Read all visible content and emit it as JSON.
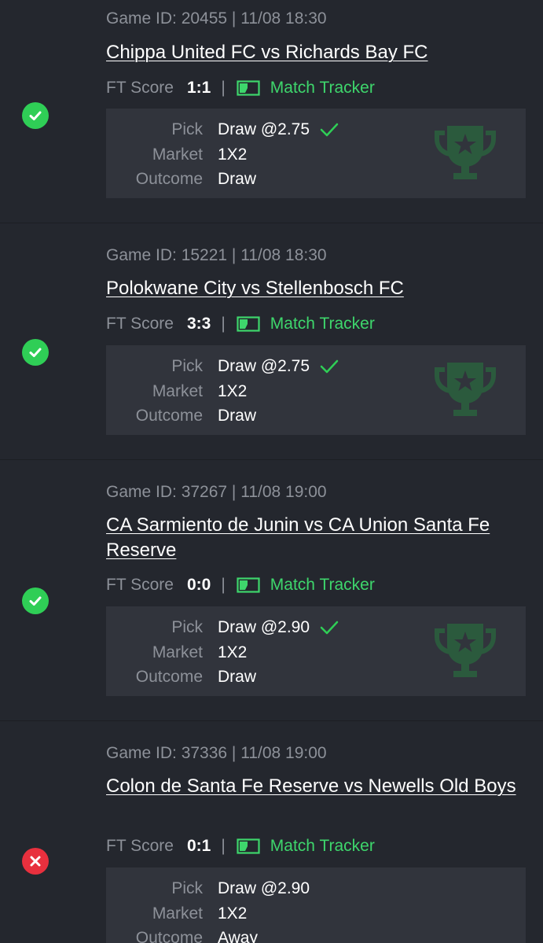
{
  "labels": {
    "ft_score": "FT Score",
    "match_tracker": "Match Tracker",
    "pick": "Pick",
    "market": "Market",
    "outcome": "Outcome",
    "separator": "|"
  },
  "colors": {
    "background": "#24272e",
    "pick_box": "#31343c",
    "won": "#2fce56",
    "lost": "#e8303e",
    "accent_green": "#3ed66c",
    "muted_text": "#8d9199"
  },
  "bets": [
    {
      "status": "won",
      "status_icon": "check-circle-icon",
      "game_id": "Game ID: 20455 | 11/08 18:30",
      "title": "Chippa United FC vs Richards Bay FC",
      "ft_score": "1:1",
      "pick": "Draw @2.75",
      "pick_correct": true,
      "market": "1X2",
      "outcome": "Draw"
    },
    {
      "status": "won",
      "status_icon": "check-circle-icon",
      "game_id": "Game ID: 15221 | 11/08 18:30",
      "title": "Polokwane City vs Stellenbosch FC",
      "ft_score": "3:3",
      "pick": "Draw @2.75",
      "pick_correct": true,
      "market": "1X2",
      "outcome": "Draw"
    },
    {
      "status": "won",
      "status_icon": "check-circle-icon",
      "game_id": "Game ID: 37267 | 11/08 19:00",
      "title": "CA Sarmiento de Junin vs CA Union Santa Fe Reserve",
      "ft_score": "0:0",
      "pick": "Draw @2.90",
      "pick_correct": true,
      "market": "1X2",
      "outcome": "Draw"
    },
    {
      "status": "lost",
      "status_icon": "x-circle-icon",
      "game_id": "Game ID: 37336 | 11/08 19:00",
      "title": "Colon de Santa Fe Reserve vs Newells Old Boys",
      "ft_score": "0:1",
      "pick": "Draw @2.90",
      "pick_correct": false,
      "market": "1X2",
      "outcome": "Away"
    }
  ]
}
